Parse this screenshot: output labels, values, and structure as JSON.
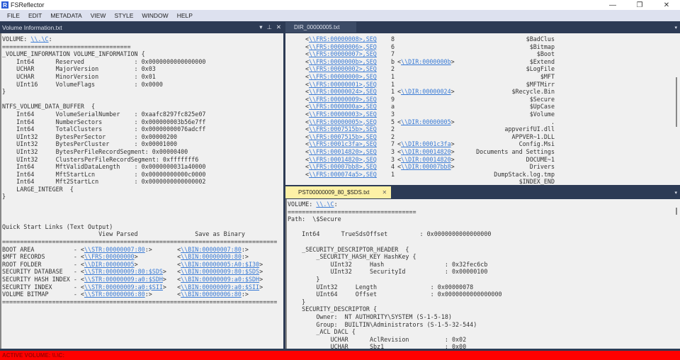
{
  "app": {
    "title": "FSReflector",
    "icon_letter": "R"
  },
  "window_controls": {
    "minimize": "—",
    "restore": "❐",
    "close": "✕"
  },
  "menu": [
    "FILE",
    "EDIT",
    "METADATA",
    "VIEW",
    "STYLE",
    "WINDOW",
    "HELP"
  ],
  "left_pane": {
    "title": "Volume Information.txt",
    "buttons": {
      "dropdown": "▾",
      "pin": "⊥",
      "close": "✕"
    },
    "lines": [
      [
        {
          "t": "VOLUME: "
        },
        {
          "l": "\\\\.\\C"
        },
        {
          "t": ":"
        }
      ],
      [
        {
          "t": "===================================="
        }
      ],
      [
        {
          "t": "_VOLUME_INFORMATION VOLUME_INFORMATION {"
        }
      ],
      [
        {
          "t": "    Int64      Reserved              : 0x0000000000000000"
        }
      ],
      [
        {
          "t": "    UCHAR      MajorVersion          : 0x03"
        }
      ],
      [
        {
          "t": "    UCHAR      MinorVersion          : 0x01"
        }
      ],
      [
        {
          "t": "    UInt16     VolumeFlags           : 0x0000"
        }
      ],
      [
        {
          "t": "}"
        }
      ],
      [
        {
          "t": ""
        }
      ],
      [
        {
          "t": "NTFS_VOLUME_DATA_BUFFER  {"
        }
      ],
      [
        {
          "t": "    Int64      VolumeSerialNumber    : 0xaafc8297fc825e07"
        }
      ],
      [
        {
          "t": "    Int64      NumberSectors         : 0x000000003b56e7ff"
        }
      ],
      [
        {
          "t": "    Int64      TotalClusters         : 0x00000000076adcff"
        }
      ],
      [
        {
          "t": "    UInt32     BytesPerSector        : 0x00000200"
        }
      ],
      [
        {
          "t": "    UInt32     BytesPerCluster       : 0x00001000"
        }
      ],
      [
        {
          "t": "    UInt32     BytesPerFileRecordSegment: 0x00000400"
        }
      ],
      [
        {
          "t": "    UInt32     ClustersPerFileRecordSegment: 0xfffffff6"
        }
      ],
      [
        {
          "t": "    Int64      MftValidDataLength    : 0x0000000031a40000"
        }
      ],
      [
        {
          "t": "    Int64      MftStartLcn           : 0x00000000000c0000"
        }
      ],
      [
        {
          "t": "    Int64      Mft2StartLcn          : 0x0000000000000002"
        }
      ],
      [
        {
          "t": "    LARGE_INTEGER  {"
        }
      ],
      [
        {
          "t": "}"
        }
      ],
      [
        {
          "t": ""
        }
      ],
      [
        {
          "t": ""
        }
      ],
      [
        {
          "t": ""
        }
      ],
      [
        {
          "t": "Quick Start Links (Text Output)"
        }
      ],
      [
        {
          "t": "                           View Parsed                Save as Binary"
        }
      ],
      [
        {
          "t": "============================================================================="
        }
      ],
      [
        {
          "t": "BOOT AREA           - <"
        },
        {
          "l": "\\\\STR:00000007:80"
        },
        {
          "t": ":>       <"
        },
        {
          "l": "\\\\BIN:00000007:80"
        },
        {
          "t": ":>"
        }
      ],
      [
        {
          "t": "$MFT RECORDS        - <"
        },
        {
          "l": "\\\\FRS:00000000"
        },
        {
          "t": ">           <"
        },
        {
          "l": "\\\\BIN:00000000:80"
        },
        {
          "t": ":>"
        }
      ],
      [
        {
          "t": "ROOT FOLDER         - <"
        },
        {
          "l": "\\\\DIR:00000005"
        },
        {
          "t": ">           <"
        },
        {
          "l": "\\\\BIN:00000005:A0:$I30"
        },
        {
          "t": ">"
        }
      ],
      [
        {
          "t": "SECURITY DATABASE   - <"
        },
        {
          "l": "\\\\STR:00000009:80:$SDS"
        },
        {
          "t": ">   <"
        },
        {
          "l": "\\\\BIN:00000009:80:$SDS"
        },
        {
          "t": ">"
        }
      ],
      [
        {
          "t": "SECURITY HASH INDEX - <"
        },
        {
          "l": "\\\\STR:00000009:a0:$SDH"
        },
        {
          "t": ">   <"
        },
        {
          "l": "\\\\BIN:00000009:a0:$SDH"
        },
        {
          "t": ">"
        }
      ],
      [
        {
          "t": "SECURITY INDEX      - <"
        },
        {
          "l": "\\\\STR:00000009:a0:$SII"
        },
        {
          "t": ">   <"
        },
        {
          "l": "\\\\BIN:00000009:a0:$SII"
        },
        {
          "t": ">"
        }
      ],
      [
        {
          "t": "VOLUME BITMAP       - <"
        },
        {
          "l": "\\\\STR:00000006:80"
        },
        {
          "t": ":>       <"
        },
        {
          "l": "\\\\BIN:00000006:80"
        },
        {
          "t": ":>"
        }
      ],
      [
        {
          "t": "============================================================================="
        }
      ]
    ]
  },
  "dir_pane": {
    "tab": "DIR_00000005.txt",
    "dropdown": "▾",
    "rows": [
      {
        "frs": "\\\\FRS:00000008>,SEQ",
        "seq": "8",
        "dir": "",
        "name": "$BadClus"
      },
      {
        "frs": "\\\\FRS:00000006>,SEQ",
        "seq": "6",
        "dir": "",
        "name": "$Bitmap"
      },
      {
        "frs": "\\\\FRS:00000007>,SEQ",
        "seq": "7",
        "dir": "",
        "name": "$Boot"
      },
      {
        "frs": "\\\\FRS:0000000b>,SEQ",
        "seq": "b",
        "dir": "\\\\DIR:0000000b",
        "name": "$Extend"
      },
      {
        "frs": "\\\\FRS:00000002>,SEQ",
        "seq": "2",
        "dir": "",
        "name": "$LogFile"
      },
      {
        "frs": "\\\\FRS:00000000>,SEQ",
        "seq": "1",
        "dir": "",
        "name": "$MFT"
      },
      {
        "frs": "\\\\FRS:00000001>,SEQ",
        "seq": "1",
        "dir": "",
        "name": "$MFTMirr"
      },
      {
        "frs": "\\\\FRS:00000024>,SEQ",
        "seq": "1",
        "dir": "\\\\DIR:00000024",
        "name": "$Recycle.Bin"
      },
      {
        "frs": "\\\\FRS:00000009>,SEQ",
        "seq": "9",
        "dir": "",
        "name": "$Secure"
      },
      {
        "frs": "\\\\FRS:0000000a>,SEQ",
        "seq": "a",
        "dir": "",
        "name": "$UpCase"
      },
      {
        "frs": "\\\\FRS:00000003>,SEQ",
        "seq": "3",
        "dir": "",
        "name": "$Volume"
      },
      {
        "frs": "\\\\FRS:00000005>,SEQ",
        "seq": "5",
        "dir": "\\\\DIR:00000005",
        "name": "."
      },
      {
        "frs": "\\\\FRS:0007515b>,SEQ",
        "seq": "2",
        "dir": "",
        "name": "appverifUI.dll"
      },
      {
        "frs": "\\\\FRS:0007515b>,SEQ",
        "seq": "2",
        "dir": "",
        "name": "APPVER~1.DLL"
      },
      {
        "frs": "\\\\FRS:0001c3fa>,SEQ",
        "seq": "7",
        "dir": "\\\\DIR:0001c3fa",
        "name": "Config.Msi"
      },
      {
        "frs": "\\\\FRS:00014820>,SEQ",
        "seq": "3",
        "dir": "\\\\DIR:00014820",
        "name": "Documents and Settings"
      },
      {
        "frs": "\\\\FRS:00014820>,SEQ",
        "seq": "3",
        "dir": "\\\\DIR:00014820",
        "name": "DOCUME~1"
      },
      {
        "frs": "\\\\FRS:00007bb8>,SEQ",
        "seq": "4",
        "dir": "\\\\DIR:00007bb8",
        "name": "Drivers"
      },
      {
        "frs": "\\\\FRS:000074a5>,SEQ",
        "seq": "1",
        "dir": "",
        "name": "DumpStack.log.tmp"
      },
      {
        "frs": "",
        "seq": "",
        "dir": "",
        "name": "$INDEX_END"
      }
    ]
  },
  "sds_pane": {
    "tab": "PST00000009_80_$SDS.txt",
    "tab_close": "✕",
    "dropdown": "▾",
    "lines": [
      [
        {
          "t": "VOLUME: "
        },
        {
          "l": "\\\\.\\C"
        },
        {
          "t": ":"
        }
      ],
      [
        {
          "t": "===================================="
        }
      ],
      [
        {
          "t": "Path:  \\$Secure"
        }
      ],
      [
        {
          "t": ""
        }
      ],
      [
        {
          "t": "    Int64      TrueSdsOffset         : 0x0000000000000000"
        }
      ],
      [
        {
          "t": ""
        }
      ],
      [
        {
          "t": "    _SECURITY_DESCRIPTOR_HEADER  {"
        }
      ],
      [
        {
          "t": "        _SECURITY_HASH_KEY HashKey {"
        }
      ],
      [
        {
          "t": "            UInt32     Hash                 : 0x32fec6cb"
        }
      ],
      [
        {
          "t": "            UInt32     SecurityId           : 0x00000100"
        }
      ],
      [
        {
          "t": "        }"
        }
      ],
      [
        {
          "t": "        UInt32     Length               : 0x00000078"
        }
      ],
      [
        {
          "t": "        UInt64     Offset               : 0x0000000000000000"
        }
      ],
      [
        {
          "t": "    }"
        }
      ],
      [
        {
          "t": "    SECURITY_DESCRIPTOR {"
        }
      ],
      [
        {
          "t": "        Owner:  NT AUTHORITY\\SYSTEM (S-1-5-18)"
        }
      ],
      [
        {
          "t": "        Group:  BUILTIN\\Administrators (S-1-5-32-544)"
        }
      ],
      [
        {
          "t": "        _ACL DACL {"
        }
      ],
      [
        {
          "t": "            UCHAR      AclRevision          : 0x02"
        }
      ],
      [
        {
          "t": "            UCHAR      Sbz1                 : 0x00"
        }
      ]
    ]
  },
  "status": {
    "text": "ACTIVE VOLUME: \\\\.\\C:"
  },
  "colors": {
    "link": "#3a7bd5",
    "header": "#2d3b55",
    "status_bar": "#ff0000",
    "active_tab": "#fdf1a6"
  }
}
